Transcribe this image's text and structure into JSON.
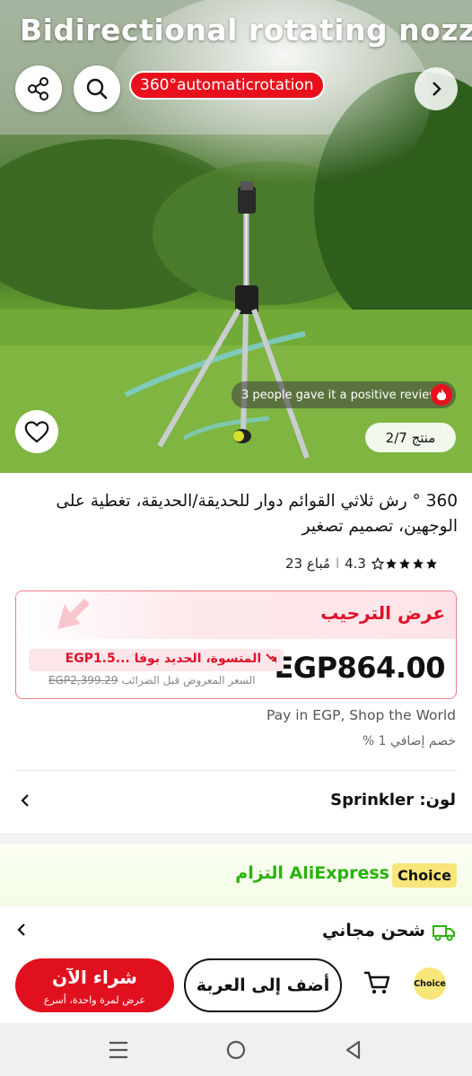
{
  "hero": {
    "overlay_title": "Bidirectional rotating nozzle",
    "badge": "360°automaticrotation",
    "review_note": "3 people gave it a positive review",
    "image_counter": "منتج 2/7",
    "icons": {
      "share": "share-nodes-icon",
      "search": "search-icon",
      "next": "chevron-right-icon",
      "favorite": "heart-icon",
      "hot": "flame-icon"
    }
  },
  "product": {
    "title": "360 ° رش ثلاثي القوائم دوار للحديقة/الحديقة، تغطية على الوجهين، تصميم تصغير",
    "rating": {
      "score": "4.3",
      "stars": 5,
      "separator": "ا",
      "sold": "23 مُباع"
    }
  },
  "offer": {
    "heading": "عرض الترحيب",
    "price": "EGP864.00",
    "savings": "المتسوة، الحديد بوفا ...EGP1.5",
    "old_price": "EGP2,399.29",
    "old_price_note": "السعر المعروض قبل الضرائب",
    "colors": {
      "accent": "#e2112b",
      "border": "#f27b86",
      "tint": "#fde6ea"
    }
  },
  "payment": {
    "pay_line": "Pay in EGP, Shop the World",
    "discount_line": "خصم إضافي 1 %"
  },
  "variant": {
    "label": "لون:",
    "value": "Sprinkler"
  },
  "choice_section": {
    "tag": "Choice",
    "title": "AliExpress التزام"
  },
  "shipping": {
    "label": "شحن مجاني"
  },
  "actions": {
    "buy_now": "شراء الآن",
    "buy_now_sub": "عرض لمرة واحدة، أسرع",
    "add_to_cart": "أضف إلى العربة",
    "choice_badge": "Choice",
    "brand_red": "#e1101f",
    "choice_yellow": "#f9e67a"
  },
  "system_nav": {
    "icons": [
      "menu-icon",
      "home-circle-icon",
      "back-triangle-icon"
    ]
  }
}
